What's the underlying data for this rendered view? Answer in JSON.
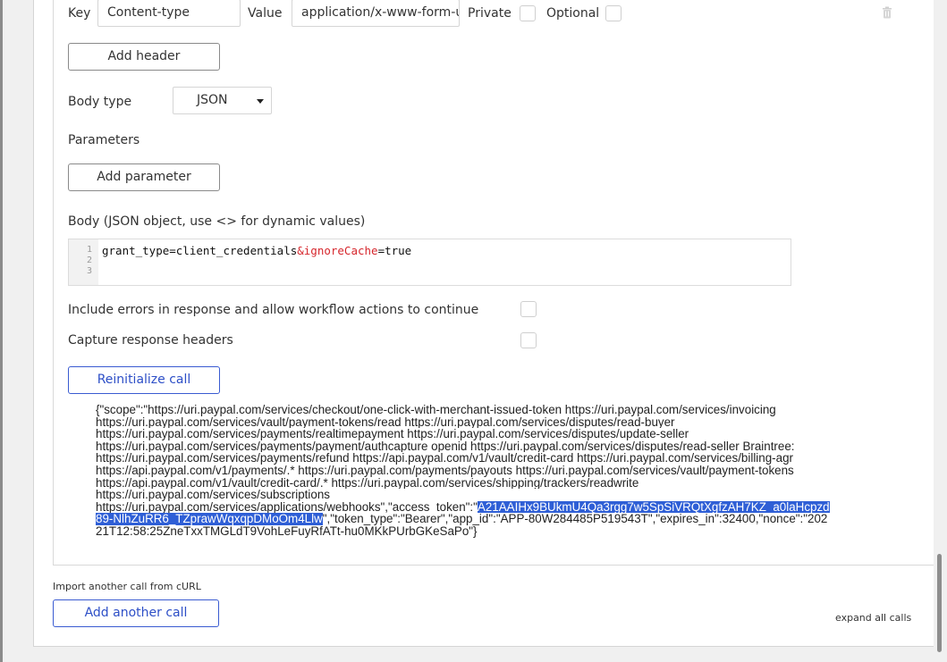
{
  "header_row": {
    "key_label": "Key",
    "key_value": "Content-type",
    "value_label": "Value",
    "value_value": "application/x-www-form-u",
    "private_label": "Private",
    "optional_label": "Optional"
  },
  "add_header_button": "Add header",
  "body_type": {
    "label": "Body type",
    "selected": "JSON"
  },
  "parameters_label": "Parameters",
  "add_parameter_button": "Add parameter",
  "body_label": "Body (JSON object, use <> for dynamic values)",
  "code_editor": {
    "line_numbers": [
      "1",
      "2",
      "3"
    ],
    "line1_part1": "grant_type=client_credentials",
    "line1_part2": "&ignoreCache",
    "line1_part3": "=true"
  },
  "include_errors_label": "Include errors in response and allow workflow actions to continue",
  "capture_headers_label": "Capture response headers",
  "reinitialize_button": "Reinitialize call",
  "response": {
    "lines": [
      "{\"scope\":\"https://uri.paypal.com/services/checkout/one-click-with-merchant-issued-token https://uri.paypal.com/services/invoicing",
      "https://uri.paypal.com/services/vault/payment-tokens/read https://uri.paypal.com/services/disputes/read-buyer",
      "https://uri.paypal.com/services/payments/realtimepayment https://uri.paypal.com/services/disputes/update-seller",
      "https://uri.paypal.com/services/payments/payment/authcapture openid https://uri.paypal.com/services/disputes/read-seller Braintree:",
      "https://uri.paypal.com/services/payments/refund https://api.paypal.com/v1/vault/credit-card https://uri.paypal.com/services/billing-agr",
      "https://api.paypal.com/v1/payments/.* https://uri.paypal.com/payments/payouts https://uri.paypal.com/services/vault/payment-tokens",
      "https://api.paypal.com/v1/vault/credit-card/.* https://uri.paypal.com/services/shipping/trackers/readwrite",
      "https://uri.paypal.com/services/subscriptions"
    ],
    "line9_plain": "https://uri.paypal.com/services/applications/webhooks\",\"access_token\":\"",
    "line9_selected": "A21AAIHx9BUkmU4Qa3rgg7w5SpSiVRQtXgfzAH7KZ_a0laHcpzd",
    "line10_selected": "89-NlhZuRR6_TZprawWqxqpDMoOm4Llw",
    "line10_plain": "\",\"token_type\":\"Bearer\",\"app_id\":\"APP-80W284485P519543T\",\"expires_in\":32400,\"nonce\":\"202",
    "line11": "21T12:58:25ZneTxxTMGLdT9VohLeFuyRfATt-hu0MKkPUrbGKeSaPo\"}"
  },
  "import_label": "Import another call from cURL",
  "add_another_call_button": "Add another call",
  "expand_all_label": "expand all calls",
  "colors": {
    "accent_blue": "#2d4fc7",
    "selection": "#2f5fd6"
  }
}
